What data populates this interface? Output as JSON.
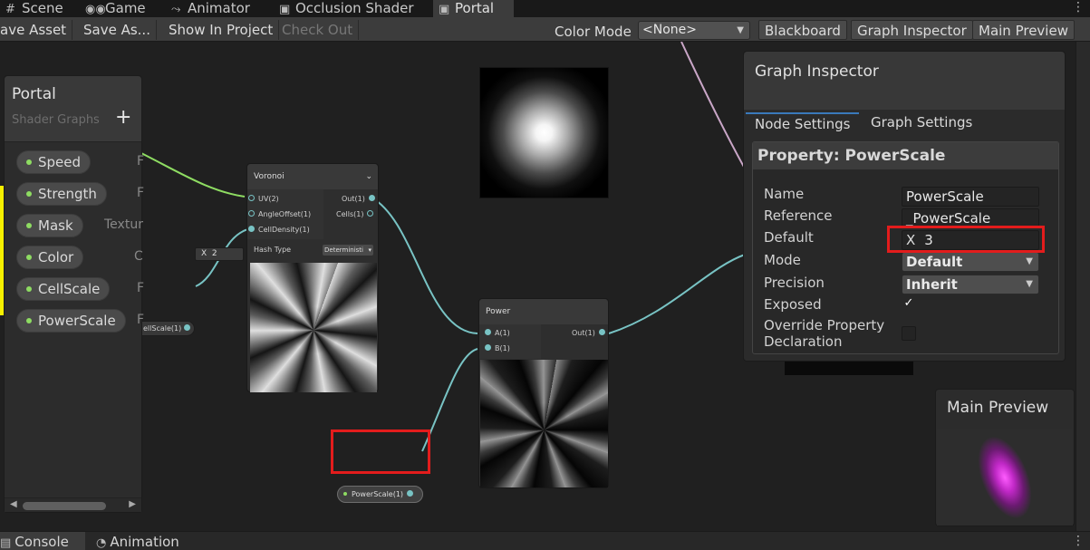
{
  "tabs": [
    {
      "label": "Scene",
      "icon": "hash-icon"
    },
    {
      "label": "Game",
      "icon": "gamepad-icon"
    },
    {
      "label": "Animator",
      "icon": "animator-icon"
    },
    {
      "label": "Occlusion Shader",
      "icon": "shader-icon"
    },
    {
      "label": "Portal",
      "icon": "shader-icon"
    }
  ],
  "toolbar": {
    "save_asset": "ave Asset",
    "save_as": "Save As...",
    "show_in_project": "Show In Project",
    "check_out": "Check Out",
    "color_mode_label": "Color Mode",
    "color_mode_value": "<None>",
    "blackboard": "Blackboard",
    "graph_inspector": "Graph Inspector",
    "main_preview": "Main Preview"
  },
  "blackboard": {
    "title": "Portal",
    "subtitle": "Shader Graphs",
    "add": "+",
    "properties": [
      {
        "name": "Speed",
        "type": "F"
      },
      {
        "name": "Strength",
        "type": "F"
      },
      {
        "name": "Mask",
        "type": "Textur"
      },
      {
        "name": "Color",
        "type": "C"
      },
      {
        "name": "CellScale",
        "type": "F"
      },
      {
        "name": "PowerScale",
        "type": "F"
      }
    ]
  },
  "voronoi_node": {
    "title": "Voronoi",
    "inputs": [
      "UV(2)",
      "AngleOffset(1)",
      "CellDensity(1)"
    ],
    "outputs": [
      "Out(1)",
      "Cells(1)"
    ],
    "hash_type_label": "Hash Type",
    "hash_type_value": "Deterministi"
  },
  "angle_offset_input": {
    "axis": "X",
    "value": "2"
  },
  "cellscale_node": {
    "label": "ellScale(1)"
  },
  "power_node": {
    "title": "Power",
    "inputs": [
      "A(1)",
      "B(1)"
    ],
    "outputs": [
      "Out(1)"
    ]
  },
  "powerscale_node": {
    "label": "PowerScale(1)"
  },
  "inspector": {
    "title": "Graph Inspector",
    "tabs": [
      "Node Settings",
      "Graph Settings"
    ],
    "property_title": "Property: PowerScale",
    "rows": {
      "name_label": "Name",
      "name_value": "PowerScale",
      "reference_label": "Reference",
      "reference_value": "_PowerScale",
      "default_label": "Default",
      "default_axis": "X",
      "default_value": "3",
      "mode_label": "Mode",
      "mode_value": "Default",
      "precision_label": "Precision",
      "precision_value": "Inherit",
      "exposed_label": "Exposed",
      "exposed_check": "✓",
      "override_label_1": "Override Property",
      "override_label_2": "Declaration"
    }
  },
  "main_preview": {
    "title": "Main Preview"
  },
  "bottom_tabs": [
    {
      "label": "Console",
      "icon": "console-icon"
    },
    {
      "label": "Animation",
      "icon": "animation-icon"
    }
  ],
  "colors": {
    "highlight_red": "#e31c1c",
    "port_teal": "#78c3c4",
    "port_green": "#8edc62",
    "accent_blue": "#3a79bb"
  }
}
